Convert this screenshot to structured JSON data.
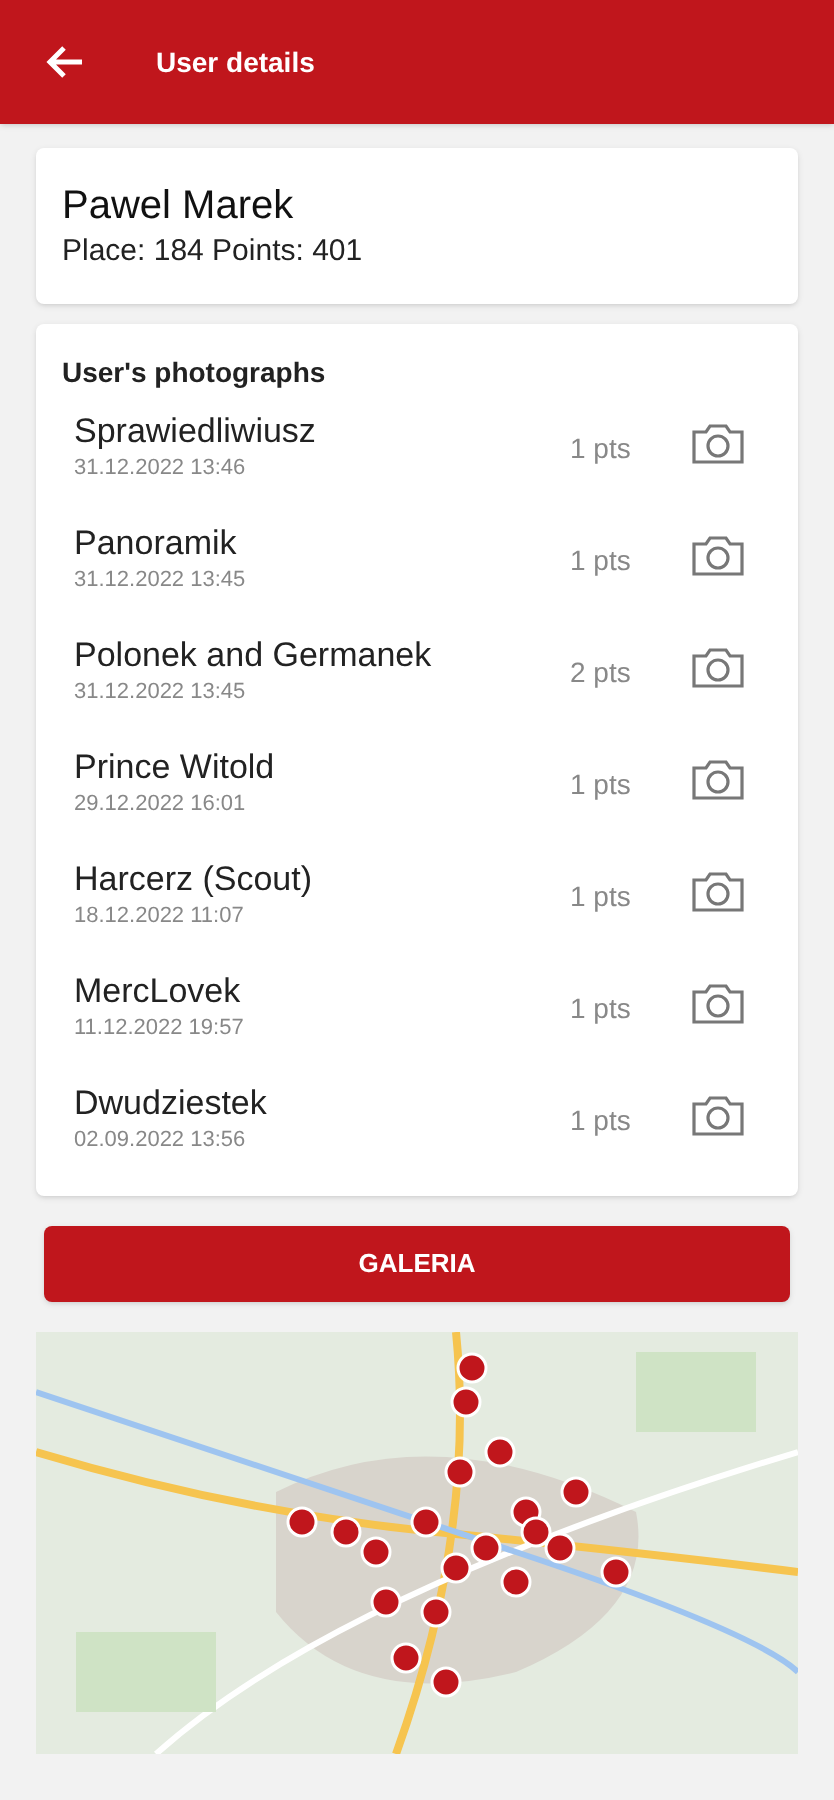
{
  "app_bar": {
    "title": "User details"
  },
  "user": {
    "name": "Pawel Marek",
    "stats": "Place: 184 Points: 401"
  },
  "photos": {
    "title": "User's photographs",
    "items": [
      {
        "name": "Sprawiedliwiusz",
        "date": "31.12.2022 13:46",
        "points": "1 pts"
      },
      {
        "name": "Panoramik",
        "date": "31.12.2022 13:45",
        "points": "1 pts"
      },
      {
        "name": "Polonek and Germanek",
        "date": "31.12.2022 13:45",
        "points": "2 pts"
      },
      {
        "name": "Prince Witold",
        "date": "29.12.2022 16:01",
        "points": "1 pts"
      },
      {
        "name": "Harcerz (Scout)",
        "date": "18.12.2022 11:07",
        "points": "1 pts"
      },
      {
        "name": "MercLovek",
        "date": "11.12.2022 19:57",
        "points": "1 pts"
      },
      {
        "name": "Dwudziestek",
        "date": "02.09.2022 13:56",
        "points": "1 pts"
      }
    ]
  },
  "gallery_button": {
    "label": "GALERIA"
  }
}
